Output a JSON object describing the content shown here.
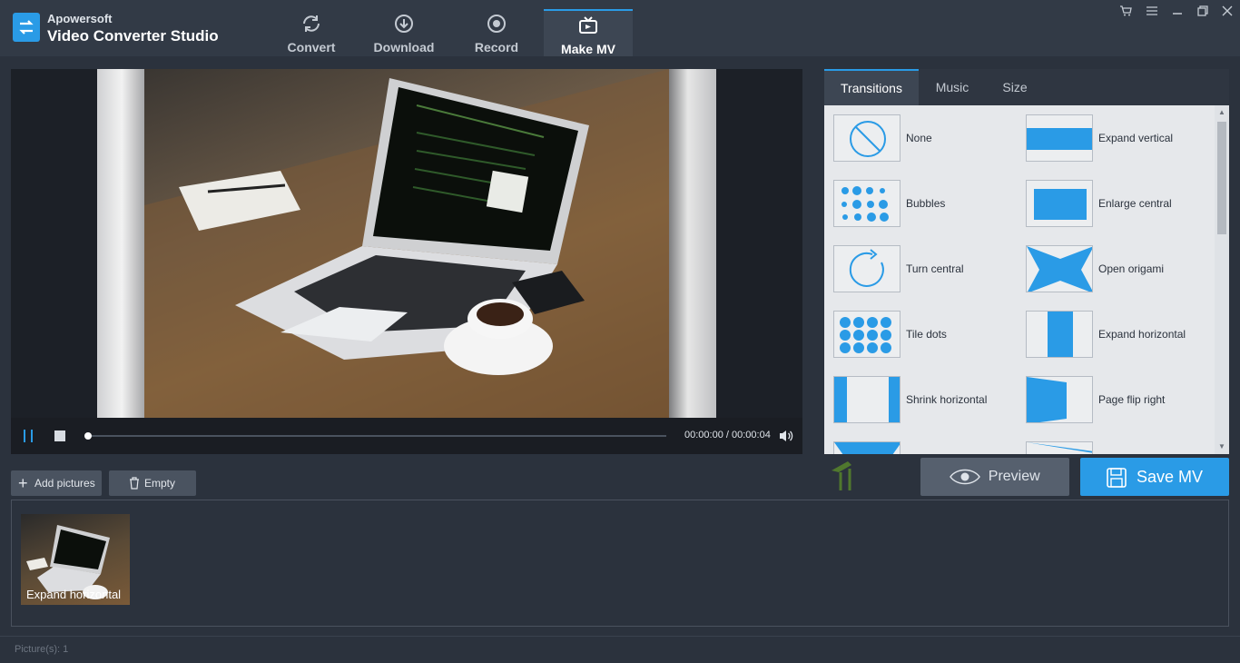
{
  "app": {
    "brand_small": "Apowersoft",
    "brand_large": "Video Converter Studio",
    "accent": "#2a9be6"
  },
  "nav": [
    {
      "label": "Convert",
      "icon": "refresh-icon"
    },
    {
      "label": "Download",
      "icon": "download-icon"
    },
    {
      "label": "Record",
      "icon": "record-icon"
    },
    {
      "label": "Make MV",
      "icon": "tv-icon",
      "active": true
    }
  ],
  "window_controls": [
    "cart-icon",
    "menu-icon",
    "minimize-icon",
    "restore-icon",
    "close-icon"
  ],
  "player": {
    "time": "00:00:00 / 00:00:04",
    "progress": 0.0
  },
  "right_tabs": [
    {
      "label": "Transitions",
      "active": true
    },
    {
      "label": "Music"
    },
    {
      "label": "Size"
    }
  ],
  "transitions": [
    {
      "label": "None"
    },
    {
      "label": "Expand vertical"
    },
    {
      "label": "Bubbles"
    },
    {
      "label": "Enlarge central"
    },
    {
      "label": "Turn central"
    },
    {
      "label": "Open origami"
    },
    {
      "label": "Tile dots"
    },
    {
      "label": "Expand horizontal"
    },
    {
      "label": "Shrink horizontal"
    },
    {
      "label": "Page flip right"
    }
  ],
  "buttons": {
    "preview": "Preview",
    "save": "Save MV",
    "add": "Add pictures",
    "empty": "Empty"
  },
  "pictures": [
    {
      "label": "Expand horizontal"
    }
  ],
  "status": "Picture(s): 1"
}
